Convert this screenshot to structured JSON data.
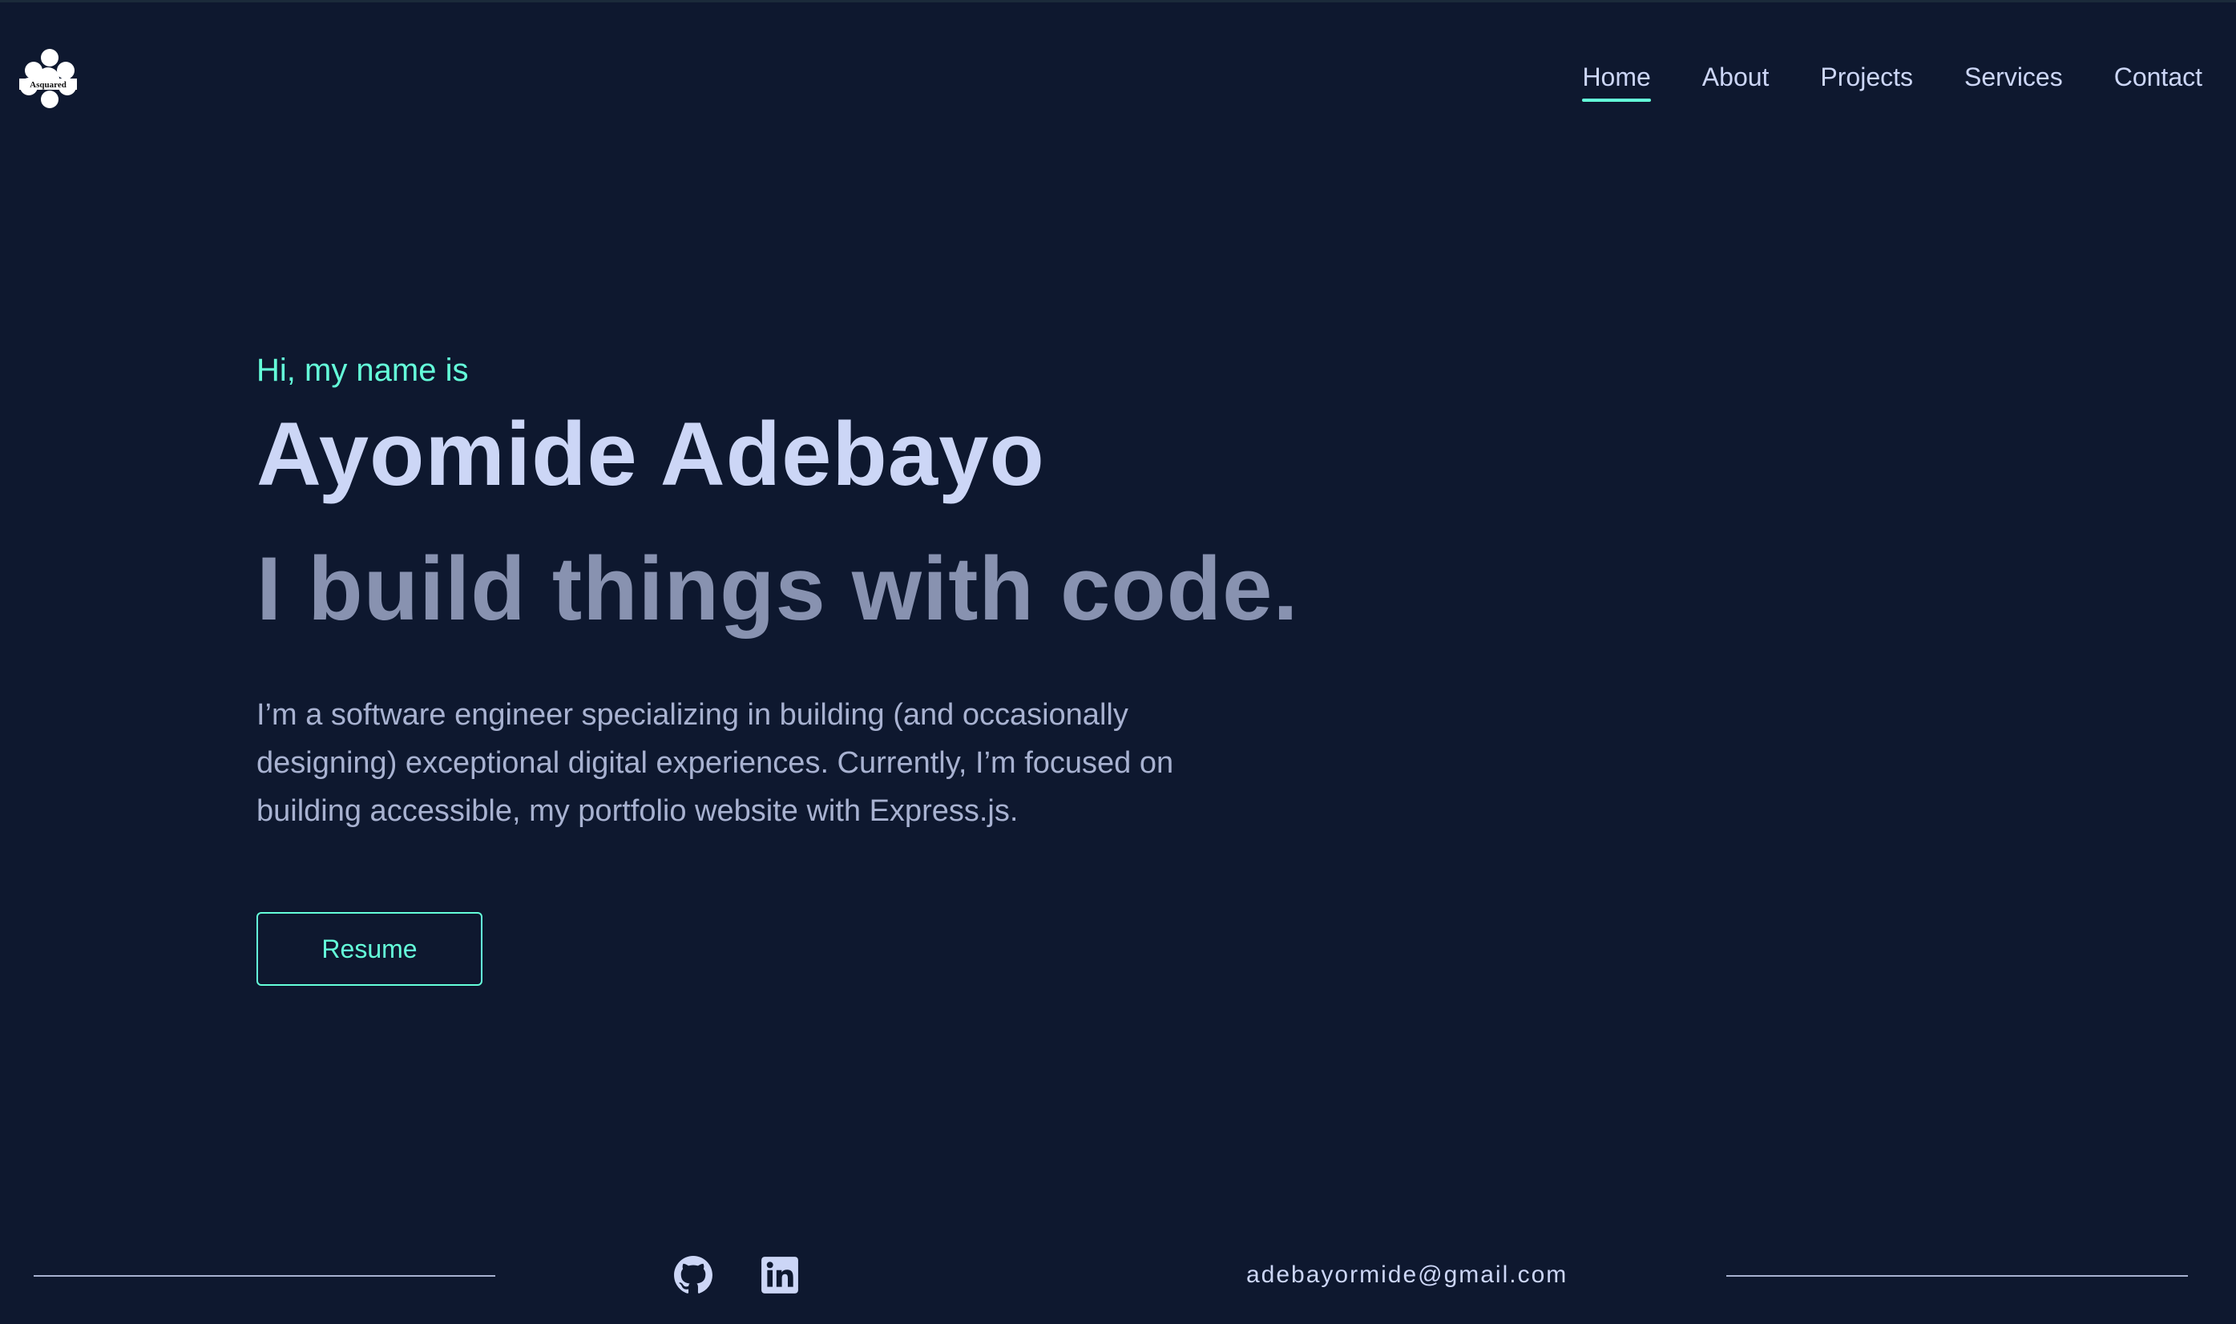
{
  "header": {
    "logo_text": "Asquared",
    "nav": [
      {
        "label": "Home",
        "active": true
      },
      {
        "label": "About",
        "active": false
      },
      {
        "label": "Projects",
        "active": false
      },
      {
        "label": "Services",
        "active": false
      },
      {
        "label": "Contact",
        "active": false
      }
    ]
  },
  "hero": {
    "greeting": "Hi, my name is",
    "name": "Ayomide Adebayo",
    "tagline": "I build things with code.",
    "description": "I’m a software engineer specializing in building (and occasionally designing) exceptional digital experiences. Currently, I’m focused on building accessible, my portfolio website with Express.js.",
    "resume_label": "Resume"
  },
  "footer": {
    "social": [
      {
        "icon": "github-icon"
      },
      {
        "icon": "linkedin-icon"
      }
    ],
    "email": "adebayormide@gmail.com"
  },
  "colors": {
    "background": "#0e182f",
    "accent": "#64ffda",
    "heading": "#ccd6f6",
    "tagline": "#8892b0",
    "body_text": "#a8b2d1"
  }
}
